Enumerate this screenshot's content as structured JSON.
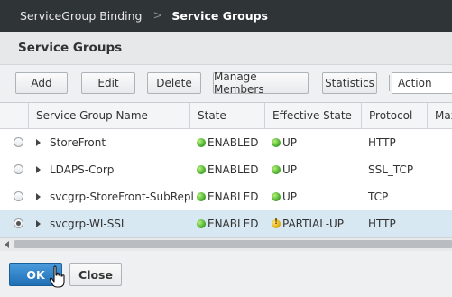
{
  "breadcrumb": {
    "parent": "ServiceGroup Binding",
    "separator": ">",
    "current": "Service Groups"
  },
  "page": {
    "title": "Service Groups"
  },
  "toolbar": {
    "add": "Add",
    "edit": "Edit",
    "delete": "Delete",
    "manage_members": "Manage Members",
    "statistics": "Statistics",
    "action": "Action"
  },
  "table": {
    "columns": [
      "Service Group Name",
      "State",
      "Effective State",
      "Protocol",
      "Max"
    ],
    "rows": [
      {
        "name": "StoreFront",
        "state": "ENABLED",
        "effective_state": "UP",
        "effective_icon": "status-up-icon",
        "protocol": "HTTP",
        "selected": false
      },
      {
        "name": "LDAPS-Corp",
        "state": "ENABLED",
        "effective_state": "UP",
        "effective_icon": "status-up-icon",
        "protocol": "SSL_TCP",
        "selected": false
      },
      {
        "name": "svcgrp-StoreFront-SubRepl",
        "state": "ENABLED",
        "effective_state": "UP",
        "effective_icon": "status-up-icon",
        "protocol": "TCP",
        "selected": false
      },
      {
        "name": "svcgrp-WI-SSL",
        "state": "ENABLED",
        "effective_state": "PARTIAL-UP",
        "effective_icon": "status-partial-icon",
        "protocol": "HTTP",
        "selected": true
      }
    ]
  },
  "footer": {
    "ok": "OK",
    "close": "Close"
  },
  "colors": {
    "topbar": "#2f3437",
    "ok_button": "#1f6fb6",
    "selected_row": "#d7e8f3",
    "status_up": "#3aa323",
    "status_partial": "#d9a400"
  }
}
